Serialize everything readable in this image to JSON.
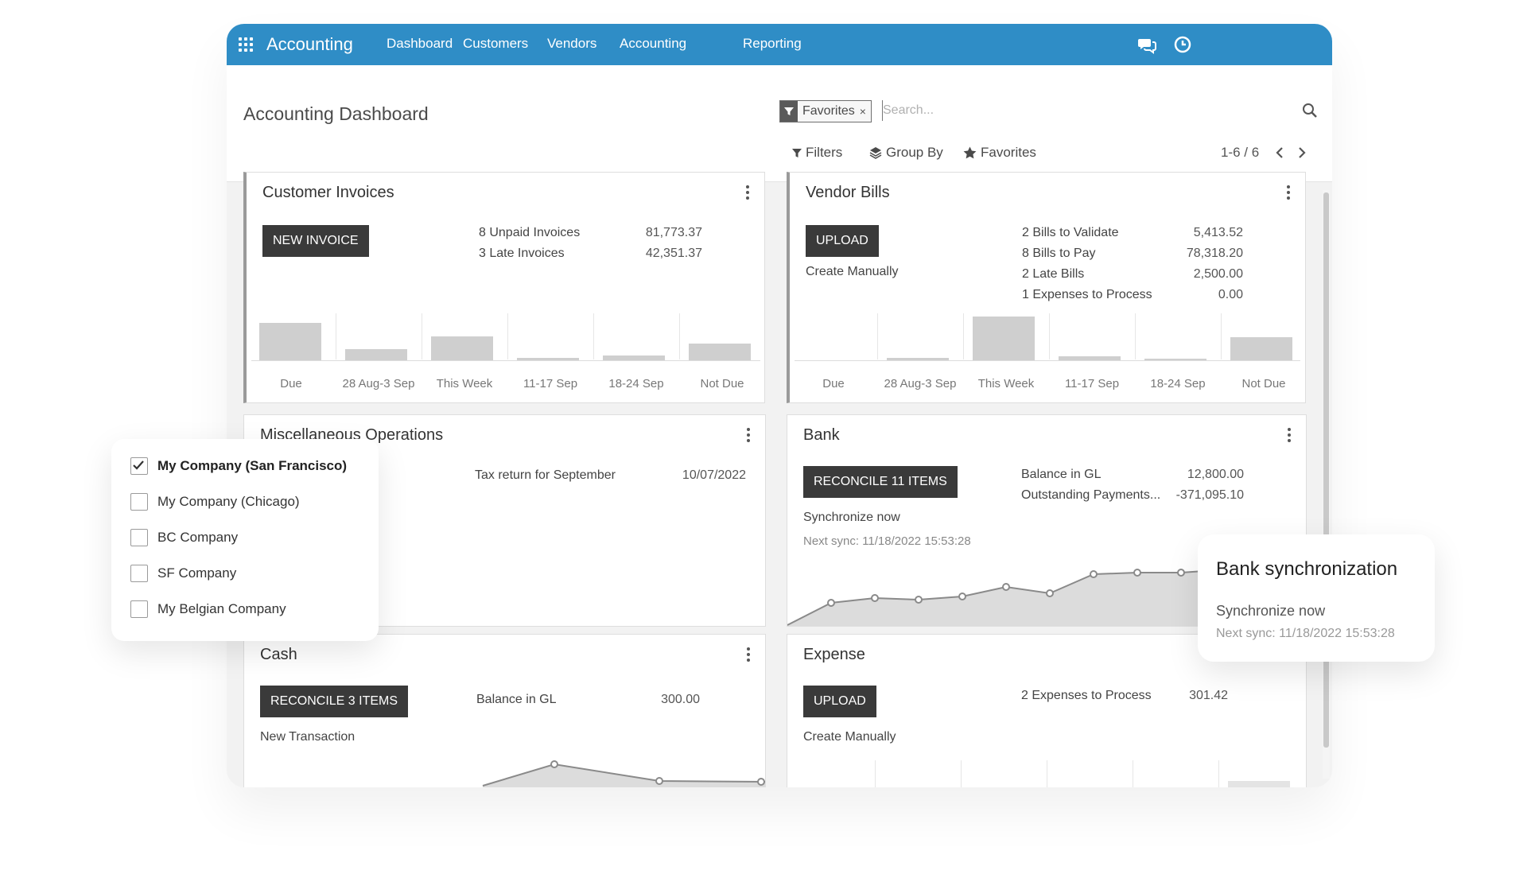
{
  "topbar": {
    "app_name": "Accounting",
    "menu": [
      "Dashboard",
      "Customers",
      "Vendors",
      "Accounting",
      "Reporting"
    ],
    "icons": [
      "apps-grid-icon",
      "chat-icon",
      "clock-icon"
    ],
    "color": "#2f8dc6"
  },
  "control_panel": {
    "title": "Accounting Dashboard",
    "facet": {
      "icon": "filter-icon",
      "value": "Favorites",
      "remove": "×"
    },
    "search_placeholder": "Search...",
    "filters_label": "Filters",
    "groupby_label": "Group By",
    "favorites_label": "Favorites",
    "pager": "1-6 / 6"
  },
  "cards": {
    "customer_invoices": {
      "title": "Customer Invoices",
      "button": "NEW INVOICE",
      "stats": [
        {
          "label": "8 Unpaid Invoices",
          "value": "81,773.37"
        },
        {
          "label": "3 Late Invoices",
          "value": "42,351.37"
        }
      ],
      "chart_categories": [
        "Due",
        "28 Aug-3 Sep",
        "This Week",
        "11-17 Sep",
        "18-24 Sep",
        "Not Due"
      ]
    },
    "vendor_bills": {
      "title": "Vendor Bills",
      "button": "UPLOAD",
      "link": "Create Manually",
      "stats": [
        {
          "label": "2 Bills to Validate",
          "value": "5,413.52"
        },
        {
          "label": "8 Bills to Pay",
          "value": "78,318.20"
        },
        {
          "label": "2 Late Bills",
          "value": "2,500.00"
        },
        {
          "label": "1 Expenses to Process",
          "value": "0.00"
        }
      ],
      "chart_categories": [
        "Due",
        "28 Aug-3 Sep",
        "This Week",
        "11-17 Sep",
        "18-24 Sep",
        "Not Due"
      ]
    },
    "misc": {
      "title": "Miscellaneous Operations",
      "item_label": "Tax return for September",
      "item_date": "10/07/2022"
    },
    "bank": {
      "title": "Bank",
      "button": "RECONCILE 11 ITEMS",
      "link": "Synchronize now",
      "next_sync": "Next sync: 11/18/2022 15:53:28",
      "stats": [
        {
          "label": "Balance in GL",
          "value": "12,800.00"
        },
        {
          "label": "Outstanding Payments...",
          "value": "-371,095.10"
        }
      ]
    },
    "cash": {
      "title": "Cash",
      "button": "RECONCILE 3 ITEMS",
      "link": "New Transaction",
      "stats": [
        {
          "label": "Balance in GL",
          "value": "300.00"
        }
      ]
    },
    "expense": {
      "title": "Expense",
      "button": "UPLOAD",
      "link": "Create Manually",
      "stats": [
        {
          "label": "2 Expenses to Process",
          "value": "301.42"
        }
      ]
    }
  },
  "company_switcher": {
    "items": [
      {
        "label": "My Company (San Francisco)",
        "checked": true
      },
      {
        "label": "My Company (Chicago)",
        "checked": false
      },
      {
        "label": "BC Company",
        "checked": false
      },
      {
        "label": "SF Company",
        "checked": false
      },
      {
        "label": "My Belgian Company",
        "checked": false
      }
    ]
  },
  "bank_sync_popup": {
    "title": "Bank synchronization",
    "action": "Synchronize now",
    "next_sync": "Next sync: 11/18/2022 15:53:28"
  }
}
